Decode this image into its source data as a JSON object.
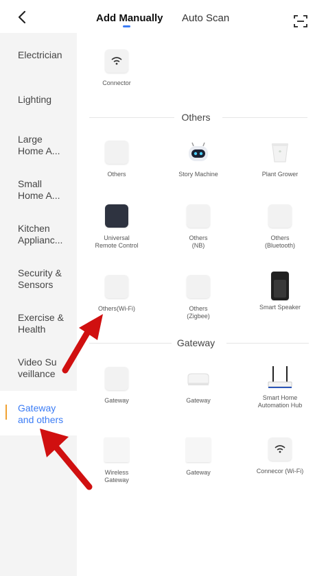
{
  "header": {
    "tabs": [
      {
        "label": "Add Manually",
        "active": true
      },
      {
        "label": "Auto Scan",
        "active": false
      }
    ]
  },
  "sidebar": {
    "items": [
      {
        "label": "Electrician"
      },
      {
        "label": "Lighting"
      },
      {
        "label": "Large\nHome A..."
      },
      {
        "label": "Small\nHome A..."
      },
      {
        "label": "Kitchen\nApplianc..."
      },
      {
        "label": "Security &\nSensors"
      },
      {
        "label": "Exercise &\nHealth"
      },
      {
        "label": "Video Su\nveillance"
      },
      {
        "label": "Gateway\nand others",
        "selected": true
      }
    ]
  },
  "main": {
    "top_devices": [
      {
        "name": "Connector",
        "icon": "wifi-icon"
      }
    ],
    "sections": [
      {
        "title": "Others",
        "devices": [
          {
            "name": "Others",
            "icon": "white-square-icon"
          },
          {
            "name": "Story Machine",
            "icon": "robot-icon"
          },
          {
            "name": "Plant Grower",
            "icon": "plant-pot-icon"
          },
          {
            "name": "Universal\nRemote Control",
            "icon": "dark-square-icon"
          },
          {
            "name": "Others\n(NB)",
            "icon": "white-square-icon"
          },
          {
            "name": "Others\n(Bluetooth)",
            "icon": "white-square-icon"
          },
          {
            "name": "Others(Wi-Fi)",
            "icon": "white-square-icon"
          },
          {
            "name": "Others\n(Zigbee)",
            "icon": "white-square-icon"
          },
          {
            "name": "Smart Speaker",
            "icon": "speaker-icon"
          }
        ]
      },
      {
        "title": "Gateway",
        "devices": [
          {
            "name": "Gateway",
            "icon": "white-square-icon"
          },
          {
            "name": "Gateway",
            "icon": "gateway-box-icon"
          },
          {
            "name": "Smart Home\nAutomation Hub",
            "icon": "router-icon"
          },
          {
            "name": "Wireless\nGateway",
            "icon": "tall-box-icon"
          },
          {
            "name": "Gateway",
            "icon": "tall-box-icon"
          },
          {
            "name": "Connecor (Wi-Fi)",
            "icon": "wifi-icon"
          }
        ]
      }
    ]
  },
  "colors": {
    "accent": "#3b7cf5",
    "selected_bar": "#f0a030",
    "annotation_arrow": "#d01010"
  }
}
